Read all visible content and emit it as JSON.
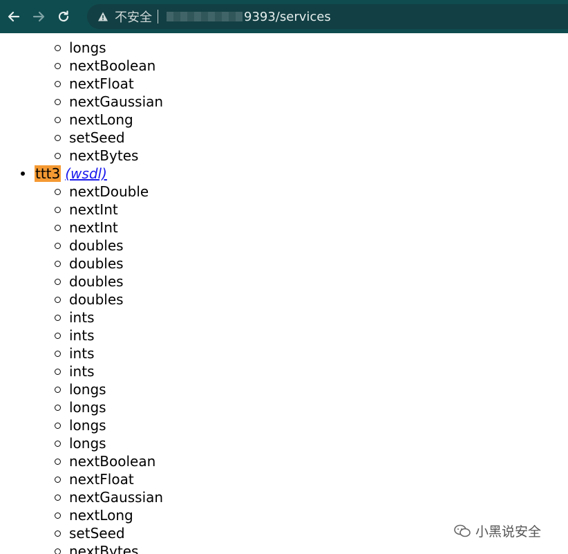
{
  "browser": {
    "insecure_label": "不安全",
    "url_suffix": "9393/services"
  },
  "services": {
    "prev_methods": [
      "longs",
      "nextBoolean",
      "nextFloat",
      "nextGaussian",
      "nextLong",
      "setSeed",
      "nextBytes"
    ],
    "ttt3": {
      "name": "ttt3",
      "wsdl_label": "(wsdl)",
      "methods": [
        "nextDouble",
        "nextInt",
        "nextInt",
        "doubles",
        "doubles",
        "doubles",
        "doubles",
        "ints",
        "ints",
        "ints",
        "ints",
        "longs",
        "longs",
        "longs",
        "longs",
        "nextBoolean",
        "nextFloat",
        "nextGaussian",
        "nextLong",
        "setSeed",
        "nextBytes"
      ]
    }
  },
  "watermark": {
    "text": "小黑说安全"
  }
}
